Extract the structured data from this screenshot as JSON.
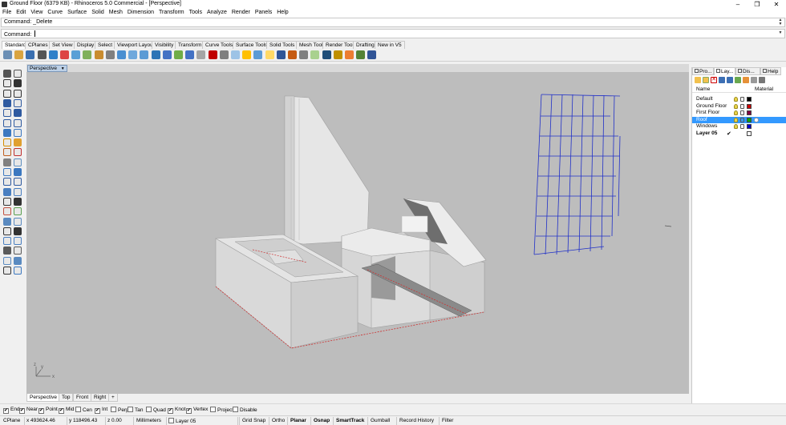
{
  "window": {
    "title": "Ground Floor (6379 KB) - Rhinoceros 5.0 Commercial - [Perspective]"
  },
  "menu": [
    "File",
    "Edit",
    "View",
    "Curve",
    "Surface",
    "Solid",
    "Mesh",
    "Dimension",
    "Transform",
    "Tools",
    "Analyze",
    "Render",
    "Panels",
    "Help"
  ],
  "command": {
    "history": "Command: _Delete",
    "prompt": "Command:",
    "value": ""
  },
  "toolbar_tabs": [
    "Standard",
    "CPlanes",
    "Set View",
    "Display",
    "Select",
    "Viewport Layout",
    "Visibility",
    "Transform",
    "Curve Tools",
    "Surface Tools",
    "Solid Tools",
    "Mesh Tools",
    "Render Tools",
    "Drafting",
    "New in V5"
  ],
  "toolbar_icons": [
    "new-icon",
    "open-icon",
    "save-icon",
    "print-icon",
    "import-icon",
    "cut-icon",
    "copy-icon",
    "paste-icon",
    "undo-icon",
    "pan-icon",
    "rotate-view-icon",
    "zoom-icon",
    "zoom-window-icon",
    "zoom-extents-icon",
    "zoom-selected-icon",
    "move-icon",
    "grid-icon",
    "select-icon",
    "car-icon",
    "hide-icon",
    "show-icon",
    "lock-icon",
    "layer-icon",
    "light-icon",
    "properties-icon",
    "render-icon",
    "sphere-icon",
    "material-icon",
    "ball-icon",
    "options-icon",
    "filter-icon",
    "texture-icon",
    "help-icon"
  ],
  "toolbar_colors": [
    "#6b8fb5",
    "#d9a441",
    "#3a6fb0",
    "#555555",
    "#2f80c9",
    "#d44",
    "#5aa0d6",
    "#7fb05a",
    "#c98c2f",
    "#808080",
    "#4a8fd1",
    "#6fa8dc",
    "#5b9bd5",
    "#2e75b6",
    "#4472c4",
    "#70ad47",
    "#4472c4",
    "#a5a5a5",
    "#c00000",
    "#7f7f7f",
    "#9dc3e6",
    "#ffc000",
    "#5b9bd5",
    "#ffd966",
    "#2f5597",
    "#c55a11",
    "#7f7f7f",
    "#a9d18e",
    "#1f4e79",
    "#bf9000",
    "#ed7d31",
    "#548235",
    "#305496"
  ],
  "viewport": {
    "tab_label": "Perspective",
    "tab_arrow": "▼"
  },
  "view_tabs": [
    "Perspective",
    "Top",
    "Front",
    "Right",
    "+"
  ],
  "axes": {
    "x": "x",
    "y": "y",
    "z": "z"
  },
  "osnaps": [
    {
      "label": "End",
      "checked": true
    },
    {
      "label": "Near",
      "checked": true
    },
    {
      "label": "Point",
      "checked": true
    },
    {
      "label": "Mid",
      "checked": true
    },
    {
      "label": "Cen",
      "checked": false
    },
    {
      "label": "Int",
      "checked": true
    },
    {
      "label": "Perp",
      "checked": false
    },
    {
      "label": "Tan",
      "checked": false
    },
    {
      "label": "Quad",
      "checked": false
    },
    {
      "label": "Knot",
      "checked": true
    },
    {
      "label": "Vertex",
      "checked": true
    },
    {
      "label": "Project",
      "checked": false
    },
    {
      "label": "Disable",
      "checked": false
    }
  ],
  "status": {
    "cplane": "CPlane",
    "x": "x 493624.46",
    "y": "y 118496.43",
    "z": "z 0.00",
    "units": "Millimeters",
    "layer": "Layer 05",
    "toggles": [
      "Grid Snap",
      "Ortho",
      "Planar",
      "Osnap",
      "SmartTrack",
      "Gumball",
      "Record History",
      "Filter"
    ]
  },
  "panel": {
    "tabs": [
      "Pro...",
      "Lay...",
      "Dis...",
      "Help"
    ],
    "col_name": "Name",
    "col_material": "Material",
    "layers": [
      {
        "name": "Default",
        "color": "#000000",
        "current": false,
        "selected": false
      },
      {
        "name": "Ground Floor",
        "color": "#cc0000",
        "current": false,
        "selected": false
      },
      {
        "name": "First Floor",
        "color": "#800040",
        "current": false,
        "selected": false
      },
      {
        "name": "Roof",
        "color": "#00aa00",
        "current": false,
        "selected": true
      },
      {
        "name": "Windows",
        "color": "#0000cc",
        "current": false,
        "selected": false
      },
      {
        "name": "Layer 05",
        "color": "#ffffff",
        "current": true,
        "selected": false
      }
    ],
    "current_mark": "✔"
  }
}
